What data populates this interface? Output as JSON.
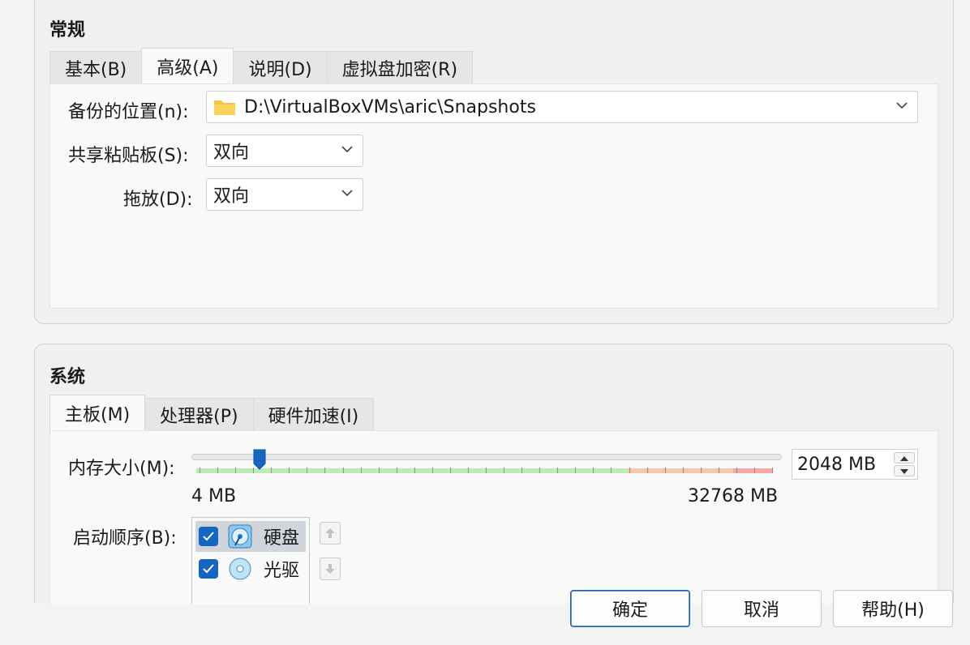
{
  "general": {
    "title": "常规",
    "tabs": [
      "基本(B)",
      "高级(A)",
      "说明(D)",
      "虚拟盘加密(R)"
    ],
    "active_tab": 1,
    "snapshot_label": "备份的位置(n):",
    "snapshot_path": "D:\\VirtualBoxVMs\\aric\\Snapshots",
    "clipboard_label": "共享粘贴板(S):",
    "clipboard_value": "双向",
    "dragdrop_label": "拖放(D):",
    "dragdrop_value": "双向"
  },
  "system": {
    "title": "系统",
    "tabs": [
      "主板(M)",
      "处理器(P)",
      "硬件加速(I)"
    ],
    "active_tab": 0,
    "memory_label": "内存大小(M):",
    "memory_value": "2048 MB",
    "memory_min_label": "4 MB",
    "memory_max_label": "32768 MB",
    "memory_fraction": 0.0624,
    "boot_label": "启动顺序(B):",
    "boot_items": [
      {
        "label": "硬盘",
        "checked": true,
        "selected": true
      },
      {
        "label": "光驱",
        "checked": true,
        "selected": false
      }
    ]
  },
  "buttons": {
    "ok": "确定",
    "cancel": "取消",
    "help": "帮助(H)"
  },
  "colors": {
    "accent": "#1566c0",
    "slider_green": "#bfe9bb",
    "slider_orange": "#f6c6ad",
    "slider_red": "#f5a8a8"
  }
}
